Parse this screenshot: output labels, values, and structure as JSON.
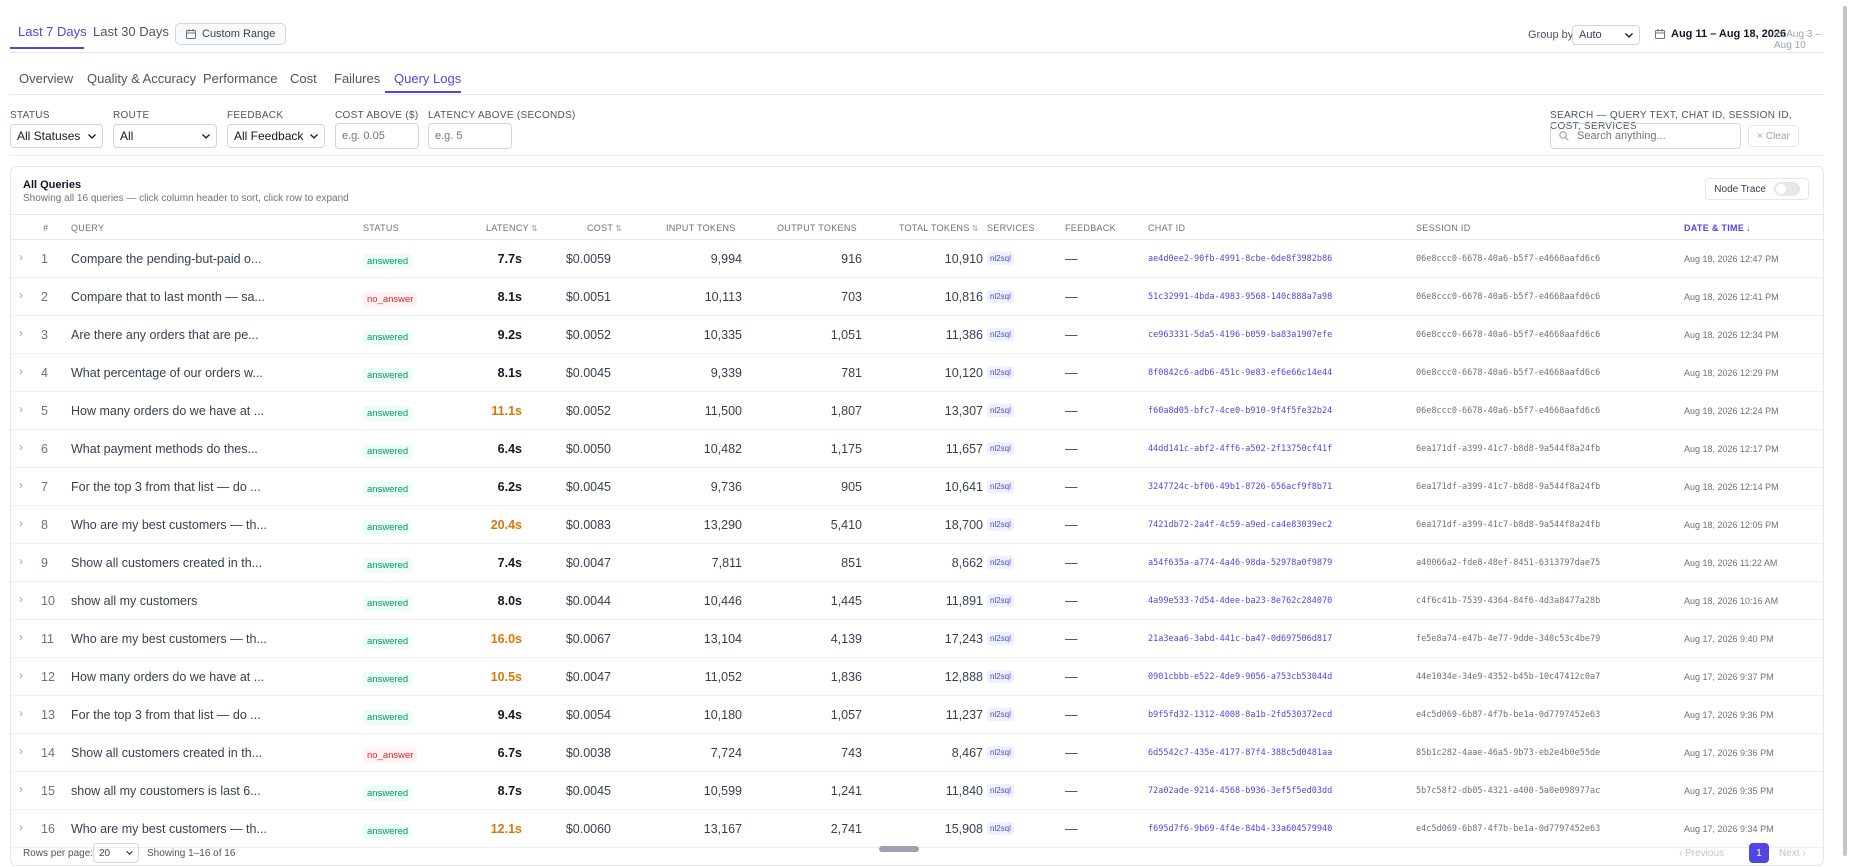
{
  "range_tabs": {
    "last7": "Last 7 Days",
    "last30": "Last 30 Days",
    "custom": "Custom Range"
  },
  "group_by": {
    "label": "Group by",
    "value": "Auto"
  },
  "date_range": {
    "current": "Aug 11 – Aug 18, 2026",
    "compare": "vs Aug 3 – Aug 10"
  },
  "tabs": [
    "Overview",
    "Quality & Accuracy",
    "Performance",
    "Cost",
    "Failures",
    "Query Logs"
  ],
  "filters": {
    "status": {
      "label": "STATUS",
      "value": "All Statuses"
    },
    "route": {
      "label": "ROUTE",
      "value": "All"
    },
    "feedback": {
      "label": "FEEDBACK",
      "value": "All Feedback"
    },
    "cost": {
      "label": "COST ABOVE ($)",
      "placeholder": "e.g. 0.05"
    },
    "latency": {
      "label": "LATENCY ABOVE (SECONDS)",
      "placeholder": "e.g. 5"
    },
    "search": {
      "label": "SEARCH — QUERY TEXT, CHAT ID, SESSION ID, COST, SERVICES",
      "placeholder": "Search anything...",
      "clear": "Clear"
    }
  },
  "card": {
    "title": "All Queries",
    "subtitle": "Showing all 16 queries — click column header to sort, click row to expand",
    "node_trace": "Node Trace"
  },
  "columns": [
    "#",
    "QUERY",
    "STATUS",
    "LATENCY",
    "COST",
    "INPUT TOKENS",
    "OUTPUT TOKENS",
    "TOTAL TOKENS",
    "SERVICES",
    "FEEDBACK",
    "CHAT ID",
    "SESSION ID",
    "DATE & TIME"
  ],
  "rows": [
    {
      "n": "1",
      "query": "Compare the pending-but-paid o...",
      "status": "answered",
      "latency": "7.7s",
      "cost": "$0.0059",
      "in": "9,994",
      "out": "916",
      "total": "10,910",
      "service": "nl2sql",
      "feedback": "—",
      "chat": "ae4d0ee2-90fb-4991-8cbe-6de8f3982b86",
      "session": "06e8ccc0-6678-40a6-b5f7-e4668aafd6c6",
      "dt": "Aug 18, 2026 12:47 PM"
    },
    {
      "n": "2",
      "query": "Compare that to last month — sa...",
      "status": "no_answer",
      "latency": "8.1s",
      "cost": "$0.0051",
      "in": "10,113",
      "out": "703",
      "total": "10,816",
      "service": "nl2sql",
      "feedback": "—",
      "chat": "51c32991-4bda-4983-9568-140c888a7a98",
      "session": "06e8ccc0-6678-40a6-b5f7-e4668aafd6c6",
      "dt": "Aug 18, 2026 12:41 PM"
    },
    {
      "n": "3",
      "query": "Are there any orders that are pe...",
      "status": "answered",
      "latency": "9.2s",
      "cost": "$0.0052",
      "in": "10,335",
      "out": "1,051",
      "total": "11,386",
      "service": "nl2sql",
      "feedback": "—",
      "chat": "ce963331-5da5-4196-b059-ba83a1907efe",
      "session": "06e8ccc0-6678-40a6-b5f7-e4668aafd6c6",
      "dt": "Aug 18, 2026 12:34 PM"
    },
    {
      "n": "4",
      "query": "What percentage of our orders w...",
      "status": "answered",
      "latency": "8.1s",
      "cost": "$0.0045",
      "in": "9,339",
      "out": "781",
      "total": "10,120",
      "service": "nl2sql",
      "feedback": "—",
      "chat": "8f0842c6-adb6-451c-9e83-ef6e66c14e44",
      "session": "06e8ccc0-6678-40a6-b5f7-e4668aafd6c6",
      "dt": "Aug 18, 2026 12:29 PM"
    },
    {
      "n": "5",
      "query": "How many orders do we have at ...",
      "status": "answered",
      "latency": "11.1s",
      "cost": "$0.0052",
      "in": "11,500",
      "out": "1,807",
      "total": "13,307",
      "service": "nl2sql",
      "feedback": "—",
      "chat": "f60a8d05-bfc7-4ce0-b910-9f4f5fe32b24",
      "session": "06e8ccc0-6678-40a6-b5f7-e4668aafd6c6",
      "dt": "Aug 18, 2026 12:24 PM"
    },
    {
      "n": "6",
      "query": "What payment methods do thes...",
      "status": "answered",
      "latency": "6.4s",
      "cost": "$0.0050",
      "in": "10,482",
      "out": "1,175",
      "total": "11,657",
      "service": "nl2sql",
      "feedback": "—",
      "chat": "44dd141c-abf2-4ff6-a502-2f13750cf41f",
      "session": "6ea171df-a399-41c7-b8d8-9a544f8a24fb",
      "dt": "Aug 18, 2026 12:17 PM"
    },
    {
      "n": "7",
      "query": "For the top 3 from that list — do ...",
      "status": "answered",
      "latency": "6.2s",
      "cost": "$0.0045",
      "in": "9,736",
      "out": "905",
      "total": "10,641",
      "service": "nl2sql",
      "feedback": "—",
      "chat": "3247724c-bf06-49b1-8726-656acf9f8b71",
      "session": "6ea171df-a399-41c7-b8d8-9a544f8a24fb",
      "dt": "Aug 18, 2026 12:14 PM"
    },
    {
      "n": "8",
      "query": "Who are my best customers — th...",
      "status": "answered",
      "latency": "20.4s",
      "cost": "$0.0083",
      "in": "13,290",
      "out": "5,410",
      "total": "18,700",
      "service": "nl2sql",
      "feedback": "—",
      "chat": "7421db72-2a4f-4c59-a9ed-ca4e83039ec2",
      "session": "6ea171df-a399-41c7-b8d8-9a544f8a24fb",
      "dt": "Aug 18, 2026 12:05 PM"
    },
    {
      "n": "9",
      "query": "Show all customers created in th...",
      "status": "answered",
      "latency": "7.4s",
      "cost": "$0.0047",
      "in": "7,811",
      "out": "851",
      "total": "8,662",
      "service": "nl2sql",
      "feedback": "—",
      "chat": "a54f635a-a774-4a46-98da-52978a0f9879",
      "session": "a40066a2-fde8-48ef-8451-6313797dae75",
      "dt": "Aug 18, 2026 11:22 AM"
    },
    {
      "n": "10",
      "query": "show all my customers",
      "status": "answered",
      "latency": "8.0s",
      "cost": "$0.0044",
      "in": "10,446",
      "out": "1,445",
      "total": "11,891",
      "service": "nl2sql",
      "feedback": "—",
      "chat": "4a99e533-7d54-4dee-ba23-8e762c284070",
      "session": "c4f6c41b-7539-4364-84f6-4d3a8477a28b",
      "dt": "Aug 18, 2026 10:16 AM"
    },
    {
      "n": "11",
      "query": "Who are my best customers — th...",
      "status": "answered",
      "latency": "16.0s",
      "cost": "$0.0067",
      "in": "13,104",
      "out": "4,139",
      "total": "17,243",
      "service": "nl2sql",
      "feedback": "—",
      "chat": "21a3eaa6-3abd-441c-ba47-0d697506d817",
      "session": "fe5e8a74-e47b-4e77-9dde-340c53c4be79",
      "dt": "Aug 17, 2026 9:40 PM"
    },
    {
      "n": "12",
      "query": "How many orders do we have at ...",
      "status": "answered",
      "latency": "10.5s",
      "cost": "$0.0047",
      "in": "11,052",
      "out": "1,836",
      "total": "12,888",
      "service": "nl2sql",
      "feedback": "—",
      "chat": "0901cbbb-e522-4de9-9056-a753cb53044d",
      "session": "44e1034e-34e9-4352-b45b-10c47412c0a7",
      "dt": "Aug 17, 2026 9:37 PM"
    },
    {
      "n": "13",
      "query": "For the top 3 from that list — do ...",
      "status": "answered",
      "latency": "9.4s",
      "cost": "$0.0054",
      "in": "10,180",
      "out": "1,057",
      "total": "11,237",
      "service": "nl2sql",
      "feedback": "—",
      "chat": "b9f5fd32-1312-4008-8a1b-2fd530372ecd",
      "session": "e4c5d069-6b87-4f7b-be1a-0d7797452e63",
      "dt": "Aug 17, 2026 9:36 PM"
    },
    {
      "n": "14",
      "query": "Show all customers created in th...",
      "status": "no_answer",
      "latency": "6.7s",
      "cost": "$0.0038",
      "in": "7,724",
      "out": "743",
      "total": "8,467",
      "service": "nl2sql",
      "feedback": "—",
      "chat": "6d5542c7-435e-4177-87f4-388c5d0481aa",
      "session": "85b1c282-4aae-46a5-9b73-eb2e4b0e55de",
      "dt": "Aug 17, 2026 9:36 PM"
    },
    {
      "n": "15",
      "query": "show all my coustomers is last 6...",
      "status": "answered",
      "latency": "8.7s",
      "cost": "$0.0045",
      "in": "10,599",
      "out": "1,241",
      "total": "11,840",
      "service": "nl2sql",
      "feedback": "—",
      "chat": "72a02ade-9214-4568-b936-3ef5f5ed03dd",
      "session": "5b7c58f2-db05-4321-a400-5a0e098977ac",
      "dt": "Aug 17, 2026 9:35 PM"
    },
    {
      "n": "16",
      "query": "Who are my best customers — th...",
      "status": "answered",
      "latency": "12.1s",
      "cost": "$0.0060",
      "in": "13,167",
      "out": "2,741",
      "total": "15,908",
      "service": "nl2sql",
      "feedback": "—",
      "chat": "f695d7f6-9b69-4f4e-84b4-33a604579940",
      "session": "e4c5d069-6b87-4f7b-be1a-0d7797452e63",
      "dt": "Aug 17, 2026 9:34 PM"
    }
  ],
  "footer": {
    "rows_label": "Rows per page:",
    "rows_value": "20",
    "showing": "Showing 1–16 of 16",
    "prev": "Previous",
    "page": "1",
    "next": "Next"
  },
  "colors": {
    "accent": "#4f46e5",
    "warn": "#d97706",
    "answered": "#059669",
    "no_answer": "#dc2626"
  }
}
